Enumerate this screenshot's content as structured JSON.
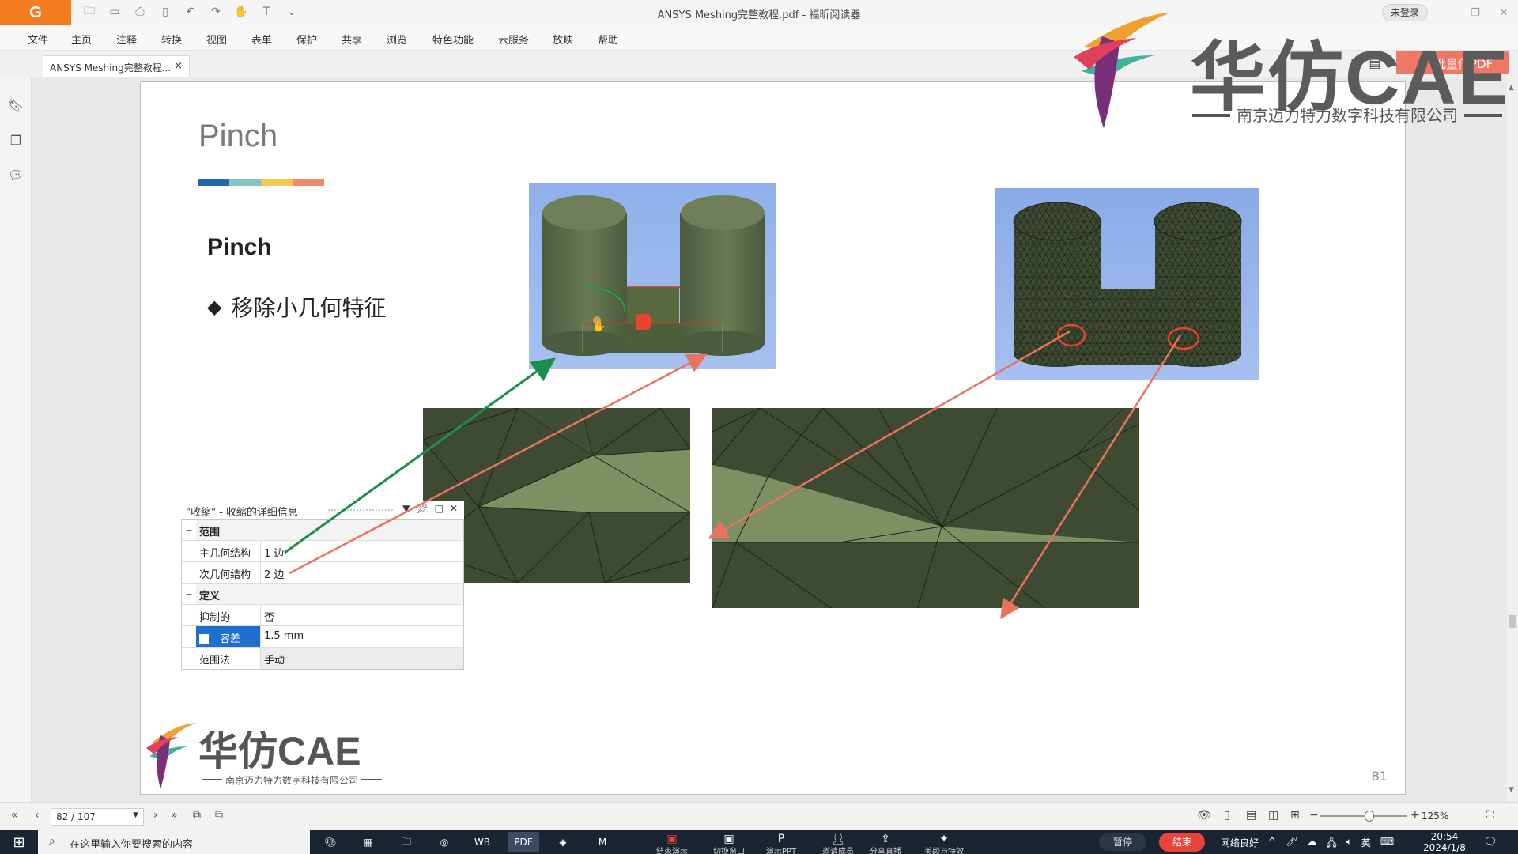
{
  "window": {
    "title": "ANSYS Meshing完整教程.pdf - 福昕阅读器",
    "login": "未登录"
  },
  "menu": [
    "文件",
    "主页",
    "注释",
    "转换",
    "视图",
    "表单",
    "保护",
    "共享",
    "浏览",
    "特色功能",
    "云服务",
    "放映",
    "帮助"
  ],
  "tab": {
    "label": "ANSYS Meshing完整教程...",
    "close": "×"
  },
  "slide": {
    "title": "Pinch",
    "colorbar": [
      "#2467a8",
      "#7fc4c8",
      "#f2c94c",
      "#f08a6a"
    ],
    "heading": "Pinch",
    "bullet_symbol": "◆",
    "bullet": "移除小几何特征",
    "page_number": "81"
  },
  "details": {
    "title": "\"收缩\" - 收缩的详细信息",
    "sections": [
      {
        "toggle": "−",
        "label": "范围",
        "rows": [
          {
            "key": "主几何结构",
            "value": "1 边"
          },
          {
            "key": "次几何结构",
            "value": "2 边"
          }
        ]
      },
      {
        "toggle": "−",
        "label": "定义",
        "rows": [
          {
            "key": "抑制的",
            "value": "否"
          },
          {
            "key": "容差",
            "value": "1.5 mm"
          },
          {
            "key": "范围法",
            "value": "手动"
          }
        ]
      }
    ]
  },
  "brand": {
    "name": "华仿CAE",
    "company": "南京迈力特力数字科技有限公司"
  },
  "upload_button": "批量传PDF",
  "statusbar": {
    "page": "82 / 107",
    "zoom": "125%"
  },
  "taskbar": {
    "search_placeholder": "在这里输入你要搜索的内容",
    "apps": [
      "WB",
      "PDF",
      "M"
    ],
    "recorder": [
      "结束演示",
      "切换窗口",
      "演示PPT",
      "邀请成员",
      "分享直播",
      "美颜与特效"
    ],
    "pause": "暂停",
    "end": "结束",
    "network": "网络良好",
    "ime": "英",
    "time": "20:54",
    "date": "2024/1/8"
  }
}
